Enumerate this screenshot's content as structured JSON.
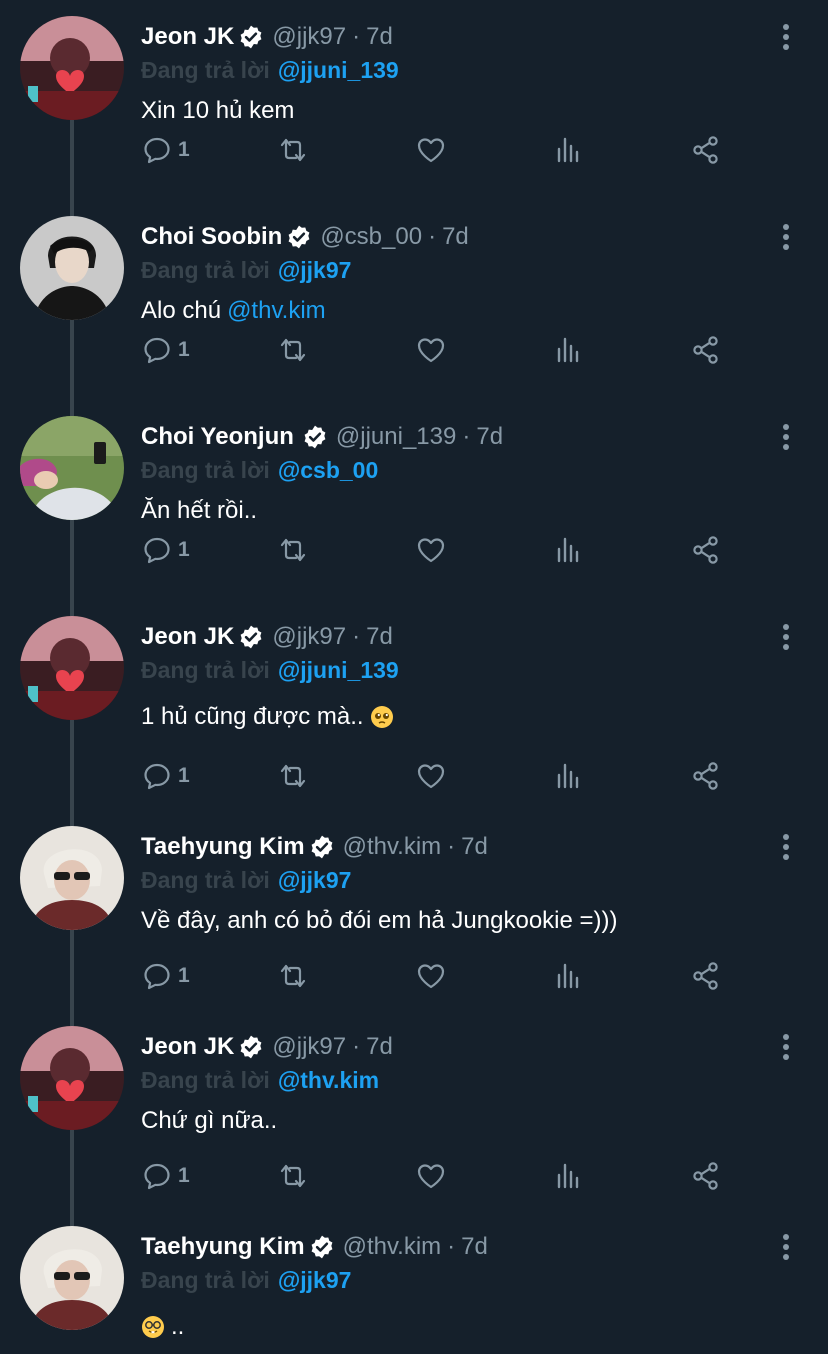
{
  "colors": {
    "background": "#15202b",
    "accent": "#1da1f2",
    "muted": "#8899a6",
    "line": "#38444d"
  },
  "icons": {
    "reply": "speech-bubble-icon",
    "retweet": "retweet-arrows-icon",
    "like": "heart-icon",
    "stats": "bar-chart-icon",
    "share": "share-icon",
    "verified": "verified-badge-icon",
    "more": "more-vertical-icon"
  },
  "tweets": [
    {
      "name": "Jeon JK",
      "handle": "@jjk97",
      "sep": "·",
      "time": "7d",
      "replying": "Đang trả lời",
      "reply_to": "@jjuni_139",
      "text": "Xin 10 hủ kem",
      "reply_count": "1",
      "avatar": "jk-avatar"
    },
    {
      "name": "Choi Soobin",
      "handle": "@csb_00",
      "sep": "·",
      "time": "7d",
      "replying": "Đang trả lời",
      "reply_to": "@jjk97",
      "text": "Alo chú",
      "mention": "@thv.kim",
      "reply_count": "1",
      "avatar": "soobin-avatar"
    },
    {
      "name": "Choi Yeonjun",
      "handle": "@jjuni_139",
      "sep": "·",
      "time": "7d",
      "replying": "Đang trả lời",
      "reply_to": "@csb_00",
      "text": "Ăn hết rồi..",
      "reply_count": "1",
      "avatar": "yeonjun-avatar"
    },
    {
      "name": "Jeon JK",
      "handle": "@jjk97",
      "sep": "·",
      "time": "7d",
      "replying": "Đang trả lời",
      "reply_to": "@jjuni_139",
      "text": "1 hủ cũng được mà..",
      "emoji": "pleading-face-emoji",
      "reply_count": "1",
      "avatar": "jk-avatar"
    },
    {
      "name": "Taehyung Kim",
      "handle": "@thv.kim",
      "sep": "·",
      "time": "7d",
      "replying": "Đang trả lời",
      "reply_to": "@jjk97",
      "text": "Về đây, anh có bỏ đói em hả Jungkookie =)))",
      "reply_count": "1",
      "avatar": "taehyung-avatar"
    },
    {
      "name": "Jeon JK",
      "handle": "@jjk97",
      "sep": "·",
      "time": "7d",
      "replying": "Đang trả lời",
      "reply_to": "@thv.kim",
      "text": "Chứ gì nữa..",
      "reply_count": "1",
      "avatar": "jk-avatar"
    },
    {
      "name": "Taehyung Kim",
      "handle": "@thv.kim",
      "sep": "·",
      "time": "7d",
      "replying": "Đang trả lời",
      "reply_to": "@jjk97",
      "text": "..",
      "emoji_lead": "nerd-face-emoji",
      "avatar": "taehyung-avatar"
    }
  ]
}
